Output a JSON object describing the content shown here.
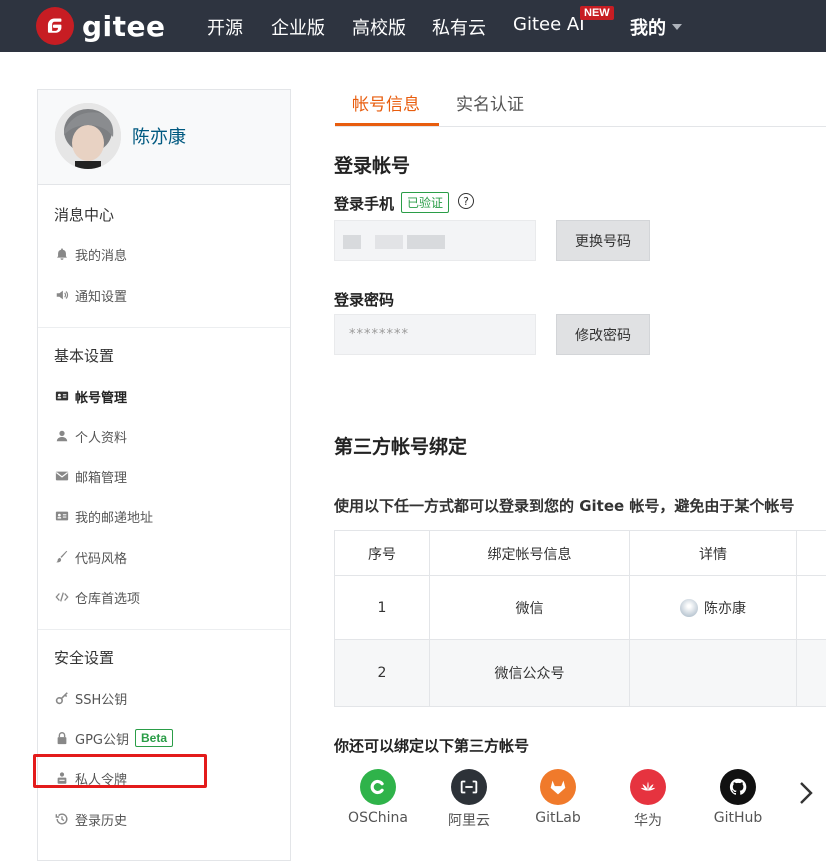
{
  "nav": {
    "brand": "gitee",
    "items": [
      "开源",
      "企业版",
      "高校版",
      "私有云",
      "Gitee AI"
    ],
    "new_badge": "NEW",
    "me": "我的",
    "brand_color": "#c71d23",
    "bg_color": "#2e3440"
  },
  "sidebar": {
    "user_name": "陈亦康",
    "sections": [
      {
        "title": "消息中心",
        "items": [
          {
            "label": "我的消息",
            "icon": "bell-icon"
          },
          {
            "label": "通知设置",
            "icon": "speaker-icon"
          }
        ]
      },
      {
        "title": "基本设置",
        "items": [
          {
            "label": "帐号管理",
            "icon": "id-card-icon"
          },
          {
            "label": "个人资料",
            "icon": "user-icon"
          },
          {
            "label": "邮箱管理",
            "icon": "envelope-icon"
          },
          {
            "label": "我的邮递地址",
            "icon": "address-card-icon"
          },
          {
            "label": "代码风格",
            "icon": "brush-icon"
          },
          {
            "label": "仓库首选项",
            "icon": "code-icon"
          }
        ]
      },
      {
        "title": "安全设置",
        "items": [
          {
            "label": "SSH公钥",
            "icon": "key-icon"
          },
          {
            "label": "GPG公钥",
            "icon": "lock-icon",
            "badge": "Beta"
          },
          {
            "label": "私人令牌",
            "icon": "token-icon"
          },
          {
            "label": "登录历史",
            "icon": "history-icon"
          }
        ]
      }
    ],
    "active_item": "帐号管理"
  },
  "tabs": [
    "帐号信息",
    "实名认证"
  ],
  "login": {
    "title": "登录帐号",
    "phone_label": "登录手机",
    "verified_badge": "已验证",
    "help": "?",
    "change_phone_button": "更换号码",
    "password_label": "登录密码",
    "password_value": "********",
    "change_password_button": "修改密码"
  },
  "third_party": {
    "title": "第三方帐号绑定",
    "description": "使用以下任一方式都可以登录到您的 Gitee 帐号，避免由于某个帐号",
    "table": {
      "headers": [
        "序号",
        "绑定帐号信息",
        "详情"
      ],
      "rows": [
        {
          "index": "1",
          "account": "微信",
          "detail": "陈亦康"
        },
        {
          "index": "2",
          "account": "微信公众号",
          "detail": ""
        }
      ]
    },
    "more_title": "你还可以绑定以下第三方帐号",
    "providers": [
      {
        "name": "OSChina",
        "color": "#2fb34a"
      },
      {
        "name": "阿里云",
        "color": "#2d3238"
      },
      {
        "name": "GitLab",
        "color": "#f07a2b"
      },
      {
        "name": "华为",
        "color": "#e6333f"
      },
      {
        "name": "GitHub",
        "color": "#111111"
      }
    ]
  }
}
